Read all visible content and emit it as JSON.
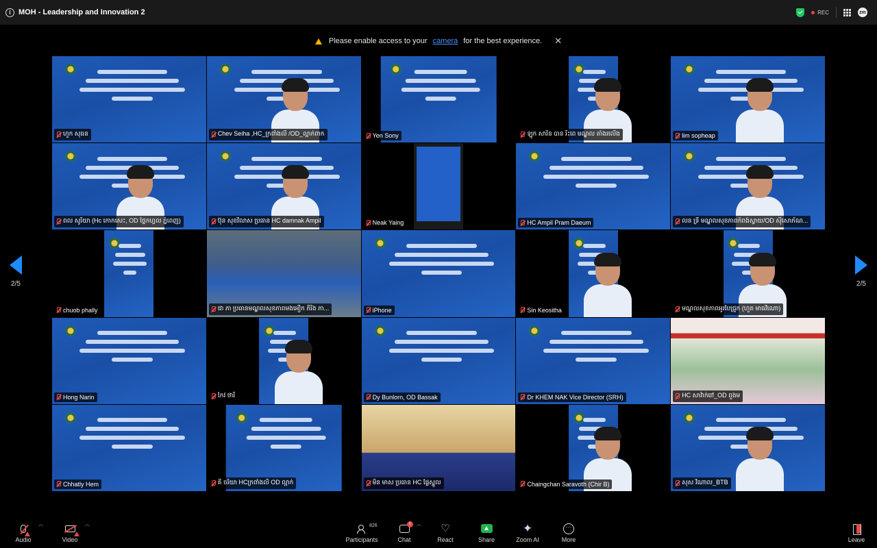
{
  "window": {
    "title": "MOH - Leadership and Innovation 2",
    "rec_label": "REC",
    "user_initials": "zm"
  },
  "banner": {
    "prefix": "Please enable access to your",
    "link": "camera",
    "suffix": "for the best experience."
  },
  "pagination": {
    "left": "2/5",
    "right": "2/5"
  },
  "tiles": [
    {
      "name": "ហួក សុធន",
      "kind": "slide"
    },
    {
      "name": "Chev Seiha ,HC_ក្រពាំងលី /OD_ល្អាក់ពាក",
      "kind": "slide-person"
    },
    {
      "name": "Yen Sony",
      "kind": "slide-mid"
    },
    {
      "name": "ឡូក សារិន បាន រឹះពេ មណ្ឌល តាំងរលើង",
      "kind": "narrow-person"
    },
    {
      "name": "lim sopheap",
      "kind": "slide-person"
    },
    {
      "name": "ពល សូរិយា (Hc កោកសេះ, OD ថ្លៃកហ្វល ភ្នំពេញ)",
      "kind": "slide-person"
    },
    {
      "name": "ប៊ុន សុខវិលាស ប្រធាន HC damnak Ampil",
      "kind": "slide-person"
    },
    {
      "name": "Neak Yaing",
      "kind": "phone"
    },
    {
      "name": "HC Ampil Pram Daeum",
      "kind": "slide"
    },
    {
      "name": "លន ទ្រី មណ្ឌលសុខភាពកំពង់ស្វាយ/OD ស៊ីសោភ័ណ...",
      "kind": "slide-person"
    },
    {
      "name": "chuob phally",
      "kind": "narrow"
    },
    {
      "name": "ជា ភា ប្រធានមណ្ឌលសុខភាពមងអឿក ភិរិង ភា...",
      "kind": "shop"
    },
    {
      "name": "iPhone",
      "kind": "slide"
    },
    {
      "name": "Sin Keositha",
      "kind": "narrow-person"
    },
    {
      "name": "មណ្ឌលសុខភាពអូរបែជ្រូក (ហួត មាធវិណោ)",
      "kind": "narrow-person"
    },
    {
      "name": "Hong Narin",
      "kind": "slide"
    },
    {
      "name": "កែវ ថារី",
      "kind": "narrow-person"
    },
    {
      "name": "Dy Bunlorn, OD Bassak",
      "kind": "slide"
    },
    {
      "name": "Dr KHEM NAK Vice Director (SRH)",
      "kind": "slide"
    },
    {
      "name": "HC សាវ៉ាក់រៅ_OD ពួងម",
      "kind": "hc"
    },
    {
      "name": "Chhatly Hem",
      "kind": "slide"
    },
    {
      "name": "គី ចរិយា HCក្រពាំងលី OD ល្អាក់",
      "kind": "slide-mid"
    },
    {
      "name": "មិន មាស ប្រធាន HC ផ្លែស្នួល",
      "kind": "room"
    },
    {
      "name": "Chaingchan Saravoth (Chir B)",
      "kind": "narrow-person"
    },
    {
      "name": "សុស វិណាល_BTB",
      "kind": "slide-person"
    }
  ],
  "toolbar": {
    "audio": "Audio",
    "video": "Video",
    "participants": "Participants",
    "participants_count": "826",
    "chat": "Chat",
    "chat_badge": "!",
    "react": "React",
    "share": "Share",
    "zoom_ai": "Zoom AI",
    "more": "More",
    "leave": "Leave"
  }
}
